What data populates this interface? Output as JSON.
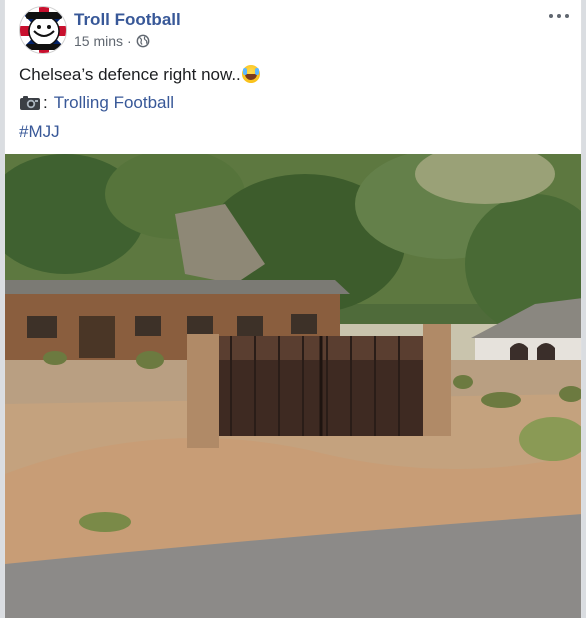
{
  "post": {
    "page_name": "Troll Football",
    "time": "15 mins",
    "separator": "·",
    "text": "Chelsea’s defence right now..",
    "credit_colon": ":",
    "credit_link": "Trolling Football",
    "hashtag": "#MJJ"
  },
  "icons": {
    "privacy": "globe-icon",
    "more": "more-options-icon",
    "credit": "camera-icon",
    "emoji": "laughing-crying-emoji"
  },
  "colors": {
    "link": "#385898",
    "meta": "#606770",
    "text": "#1c1e21"
  }
}
